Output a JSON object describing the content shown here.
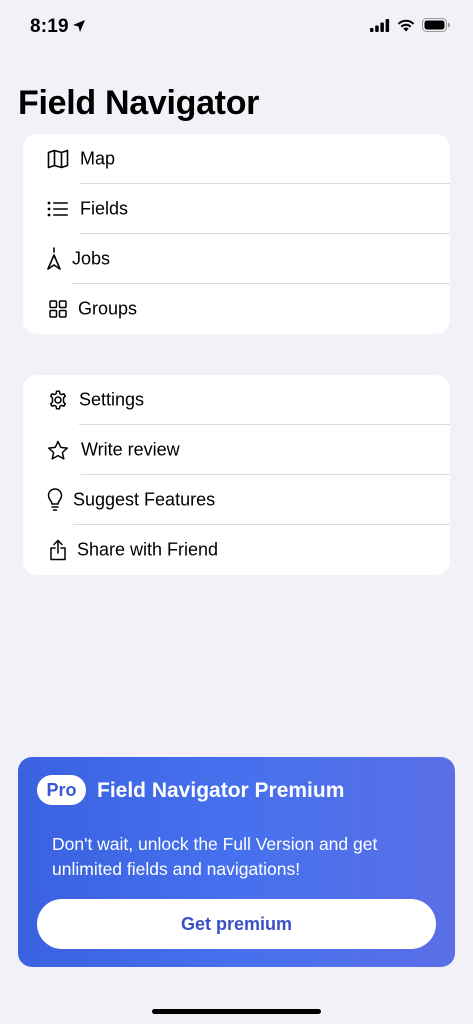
{
  "status_bar": {
    "time": "8:19"
  },
  "page_title": "Field Navigator",
  "menu_primary": [
    {
      "label": "Map",
      "icon": "map-icon"
    },
    {
      "label": "Fields",
      "icon": "list-icon"
    },
    {
      "label": "Jobs",
      "icon": "navigation-pin-icon"
    },
    {
      "label": "Groups",
      "icon": "grid-icon"
    }
  ],
  "menu_secondary": [
    {
      "label": "Settings",
      "icon": "gear-icon"
    },
    {
      "label": "Write review",
      "icon": "star-icon"
    },
    {
      "label": "Suggest Features",
      "icon": "lightbulb-icon"
    },
    {
      "label": "Share with Friend",
      "icon": "share-icon"
    }
  ],
  "premium": {
    "badge": "Pro",
    "title": "Field Navigator Premium",
    "description": "Don't wait, unlock the Full Version and get unlimited fields and navigations!",
    "button_label": "Get premium",
    "gradient_start": "#3a62e0",
    "gradient_end": "#5a6fe6"
  }
}
